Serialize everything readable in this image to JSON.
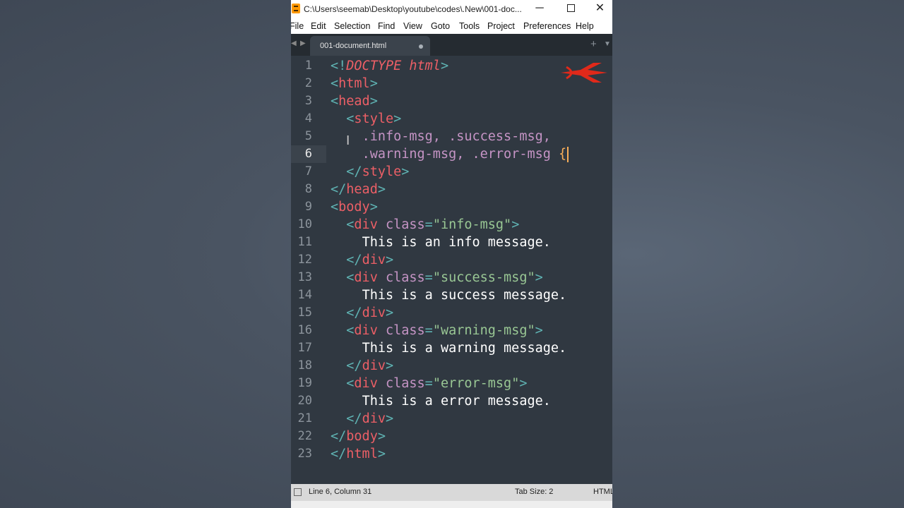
{
  "titlebar": {
    "title": "C:\\Users\\seemab\\Desktop\\youtube\\codes\\.New\\001-doc...",
    "minimize": "─",
    "close": "✕"
  },
  "menu": [
    "File",
    "Edit",
    "Selection",
    "Find",
    "View",
    "Goto",
    "Tools",
    "Project",
    "Preferences",
    "Help"
  ],
  "tab": {
    "filename": "001-document.html"
  },
  "editor": {
    "current_line": 6,
    "colors": {
      "background": "#303841",
      "tag": "#ec5f66",
      "punctuation": "#5fb3b3",
      "attribute": "#c594c5",
      "string": "#99c794",
      "text": "#ffffff",
      "brace": "#f9ae58"
    },
    "lines": [
      [
        [
          "<!",
          "pun"
        ],
        [
          "DOCTYPE html",
          "doc"
        ],
        [
          ">",
          "pun"
        ]
      ],
      [
        [
          "<",
          "pun"
        ],
        [
          "html",
          "tag"
        ],
        [
          ">",
          "pun"
        ]
      ],
      [
        [
          "<",
          "pun"
        ],
        [
          "head",
          "tag"
        ],
        [
          ">",
          "pun"
        ]
      ],
      [
        [
          "  ",
          "ws"
        ],
        [
          "<",
          "pun"
        ],
        [
          "style",
          "tag"
        ],
        [
          ">",
          "pun"
        ]
      ],
      [
        [
          "    ",
          "ws"
        ],
        [
          ".info-msg, .success-msg,",
          "sel"
        ]
      ],
      [
        [
          "    ",
          "ws"
        ],
        [
          ".warning-msg, .error-msg ",
          "sel"
        ],
        [
          "{",
          "brace"
        ]
      ],
      [
        [
          "  ",
          "ws"
        ],
        [
          "</",
          "pun"
        ],
        [
          "style",
          "tag"
        ],
        [
          ">",
          "pun"
        ]
      ],
      [
        [
          "</",
          "pun"
        ],
        [
          "head",
          "tag"
        ],
        [
          ">",
          "pun"
        ]
      ],
      [
        [
          "<",
          "pun"
        ],
        [
          "body",
          "tag"
        ],
        [
          ">",
          "pun"
        ]
      ],
      [
        [
          "  ",
          "ws"
        ],
        [
          "<",
          "pun"
        ],
        [
          "div",
          "tag"
        ],
        [
          " class",
          "attr"
        ],
        [
          "=",
          "pun"
        ],
        [
          "\"info-msg\"",
          "str"
        ],
        [
          ">",
          "pun"
        ]
      ],
      [
        [
          "    ",
          "ws"
        ],
        [
          "This is an info message.",
          "txt"
        ]
      ],
      [
        [
          "  ",
          "ws"
        ],
        [
          "</",
          "pun"
        ],
        [
          "div",
          "tag"
        ],
        [
          ">",
          "pun"
        ]
      ],
      [
        [
          "  ",
          "ws"
        ],
        [
          "<",
          "pun"
        ],
        [
          "div",
          "tag"
        ],
        [
          " class",
          "attr"
        ],
        [
          "=",
          "pun"
        ],
        [
          "\"success-msg\"",
          "str"
        ],
        [
          ">",
          "pun"
        ]
      ],
      [
        [
          "    ",
          "ws"
        ],
        [
          "This is a success message.",
          "txt"
        ]
      ],
      [
        [
          "  ",
          "ws"
        ],
        [
          "</",
          "pun"
        ],
        [
          "div",
          "tag"
        ],
        [
          ">",
          "pun"
        ]
      ],
      [
        [
          "  ",
          "ws"
        ],
        [
          "<",
          "pun"
        ],
        [
          "div",
          "tag"
        ],
        [
          " class",
          "attr"
        ],
        [
          "=",
          "pun"
        ],
        [
          "\"warning-msg\"",
          "str"
        ],
        [
          ">",
          "pun"
        ]
      ],
      [
        [
          "    ",
          "ws"
        ],
        [
          "This is a warning message.",
          "txt"
        ]
      ],
      [
        [
          "  ",
          "ws"
        ],
        [
          "</",
          "pun"
        ],
        [
          "div",
          "tag"
        ],
        [
          ">",
          "pun"
        ]
      ],
      [
        [
          "  ",
          "ws"
        ],
        [
          "<",
          "pun"
        ],
        [
          "div",
          "tag"
        ],
        [
          " class",
          "attr"
        ],
        [
          "=",
          "pun"
        ],
        [
          "\"error-msg\"",
          "str"
        ],
        [
          ">",
          "pun"
        ]
      ],
      [
        [
          "    ",
          "ws"
        ],
        [
          "This is a error message.",
          "txt"
        ]
      ],
      [
        [
          "  ",
          "ws"
        ],
        [
          "</",
          "pun"
        ],
        [
          "div",
          "tag"
        ],
        [
          ">",
          "pun"
        ]
      ],
      [
        [
          "</",
          "pun"
        ],
        [
          "body",
          "tag"
        ],
        [
          ">",
          "pun"
        ]
      ],
      [
        [
          "</",
          "pun"
        ],
        [
          "html",
          "tag"
        ],
        [
          ">",
          "pun"
        ]
      ]
    ]
  },
  "status": {
    "position": "Line 6, Column 31",
    "tab_size": "Tab Size: 2",
    "syntax": "HTML"
  }
}
